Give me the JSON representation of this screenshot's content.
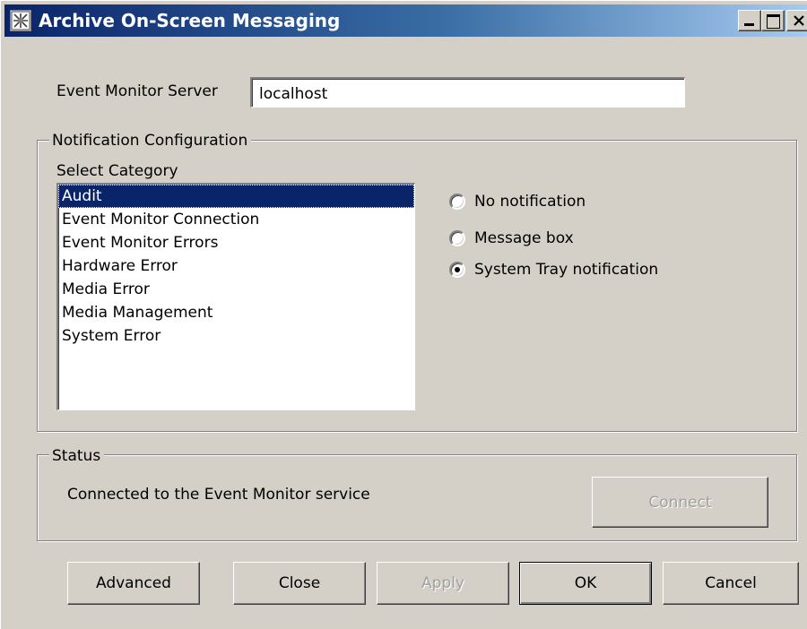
{
  "window": {
    "title": "Archive On-Screen Messaging",
    "icon": "app-grid-icon",
    "controls": [
      "minimize-icon",
      "maximize-icon",
      "close-icon"
    ]
  },
  "server": {
    "label": "Event Monitor Server",
    "value": "localhost"
  },
  "notification": {
    "group_label": "Notification Configuration",
    "select_label": "Select Category",
    "categories": [
      "Audit",
      "Event Monitor Connection",
      "Event Monitor Errors",
      "Hardware Error",
      "Media Error",
      "Media Management",
      "System Error"
    ],
    "selected_category": "Audit",
    "options": [
      {
        "label": "No notification",
        "checked": false
      },
      {
        "label": "Message box",
        "checked": false
      },
      {
        "label": "System Tray notification",
        "checked": true
      }
    ]
  },
  "status": {
    "group_label": "Status",
    "text": "Connected to the Event Monitor service",
    "connect_label": "Connect",
    "connect_enabled": false
  },
  "buttons": {
    "advanced": "Advanced",
    "close": "Close",
    "apply": "Apply",
    "apply_enabled": false,
    "ok": "OK",
    "cancel": "Cancel"
  },
  "colors": {
    "titlebar_start": "#0a246a",
    "titlebar_end": "#a6caf0",
    "selection": "#0a246a",
    "face": "#d4d0c8"
  }
}
